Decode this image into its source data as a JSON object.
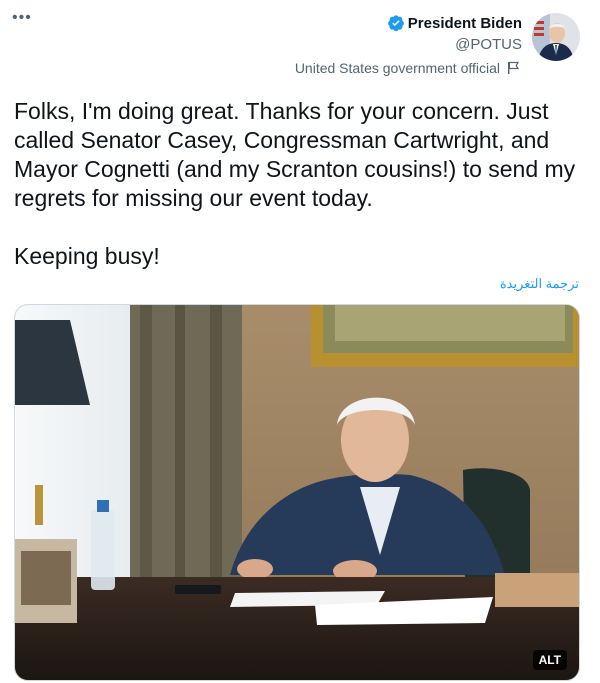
{
  "header": {
    "display_name": "President Biden",
    "handle": "@POTUS",
    "label": "United States government official",
    "verified_icon": "verified-badge-icon",
    "flag_icon": "flag-icon",
    "more_icon": "more-options-icon"
  },
  "tweet": {
    "paragraph1": "Folks, I'm doing great. Thanks for your concern. Just called Senator Casey, Congressman Cartwright, and Mayor Cognetti (and my Scranton cousins!) to send my regrets for missing our event today.",
    "paragraph2": "Keeping busy!",
    "translate_link": "ترجمة التغريدة"
  },
  "media": {
    "alt_badge": "ALT"
  },
  "colors": {
    "accent": "#1d9bf0",
    "secondary_text": "#536471",
    "primary_text": "#0f1419"
  }
}
